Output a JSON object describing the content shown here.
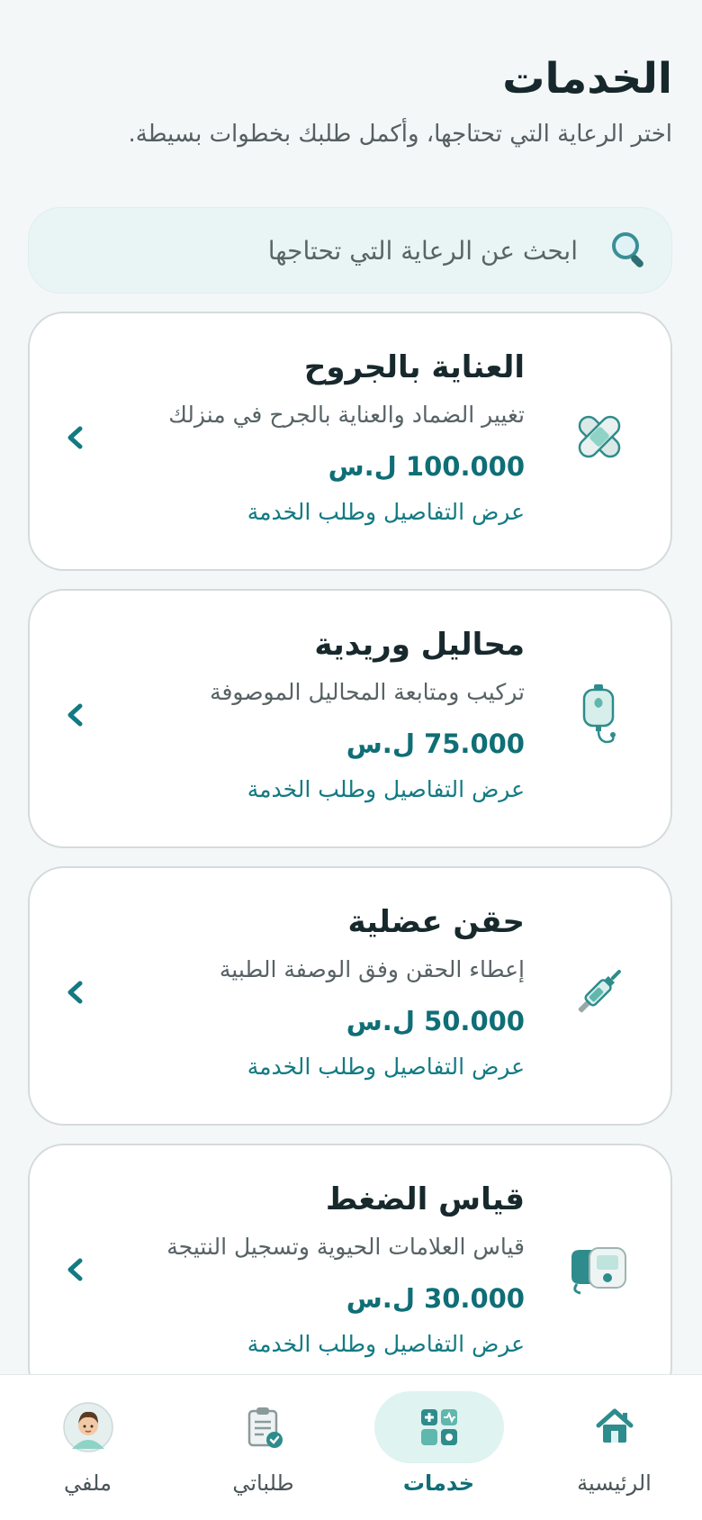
{
  "header": {
    "title": "الخدمات",
    "subtitle": "اختر الرعاية التي تحتاجها، وأكمل طلبك بخطوات بسيطة."
  },
  "search": {
    "placeholder": "ابحث عن الرعاية التي تحتاجها",
    "icon": "search-icon"
  },
  "services": [
    {
      "title": "العناية بالجروح",
      "description": "تغيير الضماد والعناية بالجرح في منزلك",
      "price": "100.000 ل.س",
      "link": "عرض التفاصيل وطلب الخدمة",
      "icon": "bandage-icon"
    },
    {
      "title": "محاليل وريدية",
      "description": "تركيب ومتابعة المحاليل الموصوفة",
      "price": "75.000 ل.س",
      "link": "عرض التفاصيل وطلب الخدمة",
      "icon": "iv-bag-icon"
    },
    {
      "title": "حقن عضلية",
      "description": "إعطاء الحقن وفق الوصفة الطبية",
      "price": "50.000 ل.س",
      "link": "عرض التفاصيل وطلب الخدمة",
      "icon": "syringe-icon"
    },
    {
      "title": "قياس الضغط",
      "description": "قياس العلامات الحيوية وتسجيل النتيجة",
      "price": "30.000 ل.س",
      "link": "عرض التفاصيل وطلب الخدمة",
      "icon": "blood-pressure-monitor-icon"
    }
  ],
  "nav": {
    "items": [
      {
        "label": "الرئيسية",
        "icon": "home-icon",
        "active": false
      },
      {
        "label": "خدمات",
        "icon": "services-icon",
        "active": true
      },
      {
        "label": "طلباتي",
        "icon": "clipboard-icon",
        "active": false
      },
      {
        "label": "ملفي",
        "icon": "avatar-icon",
        "active": false
      }
    ]
  },
  "colors": {
    "accent": "#0f6e76",
    "search_bg": "#e9f5f4",
    "active_pill": "#dff3f1",
    "page_bg": "#f4f7f8"
  }
}
